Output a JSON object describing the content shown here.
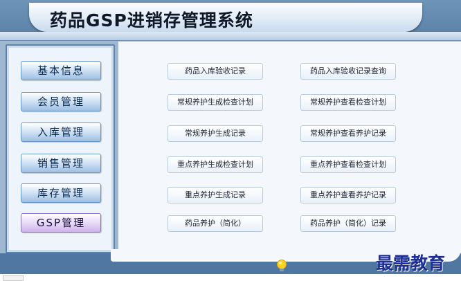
{
  "app": {
    "title": "药品GSP进销存管理系统"
  },
  "sidebar": {
    "items": [
      {
        "label": "基本信息"
      },
      {
        "label": "会员管理"
      },
      {
        "label": "入库管理"
      },
      {
        "label": "销售管理"
      },
      {
        "label": "库存管理"
      },
      {
        "label": "GSP管理",
        "active": true
      }
    ]
  },
  "main": {
    "buttons": [
      {
        "label": "药品入库验收记录"
      },
      {
        "label": "药品入库验收记录查询"
      },
      {
        "label": "常规养护生成检查计划"
      },
      {
        "label": "常规养护查看检查计划"
      },
      {
        "label": "常规养护生成记录"
      },
      {
        "label": "常规养护查看养护记录"
      },
      {
        "label": "重点养护生成检查计划"
      },
      {
        "label": "重点养护查看检查计划"
      },
      {
        "label": "重点养护生成记录"
      },
      {
        "label": "重点养护查看养护记录"
      },
      {
        "label": "药品养护（简化）"
      },
      {
        "label": "药品养护（简化）记录"
      }
    ]
  },
  "watermark": {
    "text": "最需教育"
  },
  "colors": {
    "header_bg": "#5a7fa6",
    "active_nav": "#cdb4ea",
    "nav_button": "#9ebfe2",
    "watermark": "#1f2f93"
  },
  "icons": {
    "footer": "lightbulb-icon"
  }
}
